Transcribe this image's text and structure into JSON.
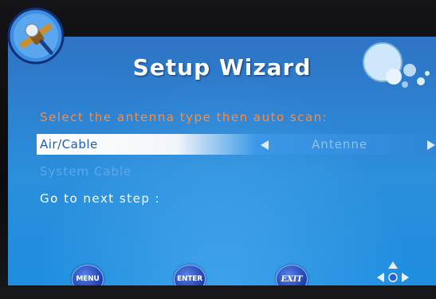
{
  "wizard": {
    "title": "Setup Wizard",
    "instruction": "Select the antenna type then auto scan:",
    "rows": [
      {
        "label": "Air/Cable",
        "value": "Antenne"
      },
      {
        "label": "System Cable"
      },
      {
        "label": "Go to next step :"
      }
    ]
  },
  "footer": {
    "buttons": [
      {
        "label": "MENU",
        "icon": "menu-button-icon"
      },
      {
        "label": "ENTER",
        "icon": "enter-button-icon"
      },
      {
        "label": "EXIT",
        "icon": "exit-button-icon"
      },
      {
        "icon": "navigation-arrows-icon"
      }
    ]
  },
  "colors": {
    "screen_blue": "#2b8fdc",
    "instruction_orange": "#ff8a3a",
    "button_blue": "#1c3fae"
  }
}
